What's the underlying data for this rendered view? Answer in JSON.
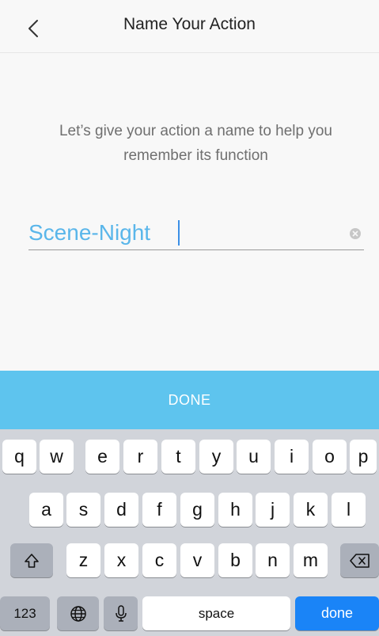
{
  "navbar": {
    "title": "Name Your Action",
    "back_icon": "chevron-left-icon"
  },
  "content": {
    "instructions": "Let’s give your action a name to help you remember its function",
    "name_field": {
      "value": "Scene-Night",
      "clear_icon": "clear-circle-icon"
    }
  },
  "done_bar": {
    "label": "DONE"
  },
  "keyboard": {
    "row1": [
      "q",
      "w",
      "e",
      "r",
      "t",
      "y",
      "u",
      "i",
      "o",
      "p"
    ],
    "row2": [
      "a",
      "s",
      "d",
      "f",
      "g",
      "h",
      "j",
      "k",
      "l"
    ],
    "row3": [
      "z",
      "x",
      "c",
      "v",
      "b",
      "n",
      "m"
    ],
    "shift_icon": "shift-icon",
    "delete_icon": "delete-backspace-icon",
    "numbers_label": "123",
    "globe_icon": "globe-icon",
    "mic_icon": "microphone-icon",
    "space_label": "space",
    "done_label": "done"
  },
  "colors": {
    "accent_blue": "#5ec4ee",
    "text_field_blue": "#5ab6ea",
    "keyboard_done_blue": "#1a84f7",
    "keyboard_bg": "#d1d4da"
  }
}
